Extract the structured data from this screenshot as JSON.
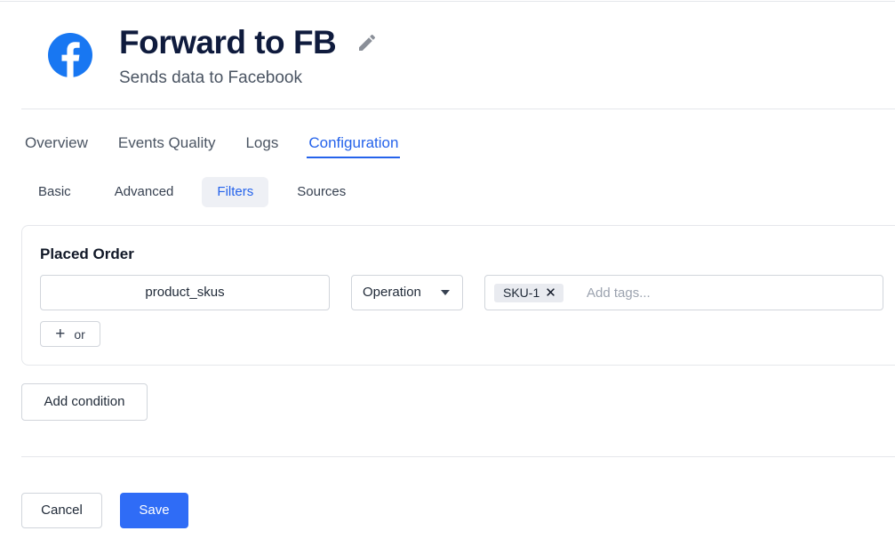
{
  "header": {
    "title": "Forward to FB",
    "subtitle": "Sends data to Facebook",
    "logo_icon": "facebook-icon",
    "edit_icon": "pencil-icon"
  },
  "tabs": [
    {
      "label": "Overview",
      "active": false
    },
    {
      "label": "Events Quality",
      "active": false
    },
    {
      "label": "Logs",
      "active": false
    },
    {
      "label": "Configuration",
      "active": true
    }
  ],
  "subtabs": [
    {
      "label": "Basic",
      "active": false
    },
    {
      "label": "Advanced",
      "active": false
    },
    {
      "label": "Filters",
      "active": true
    },
    {
      "label": "Sources",
      "active": false
    }
  ],
  "filter_card": {
    "title": "Placed Order",
    "field_value": "product_skus",
    "operation": "Operation",
    "tags": [
      "SKU-1"
    ],
    "tags_placeholder": "Add tags...",
    "or_label": "or"
  },
  "actions": {
    "add_condition": "Add condition",
    "cancel": "Cancel",
    "save": "Save"
  },
  "colors": {
    "accent": "#2563eb",
    "save_button": "#2f6cf6",
    "facebook_blue": "#1877f2",
    "title": "#0f1b3d"
  }
}
